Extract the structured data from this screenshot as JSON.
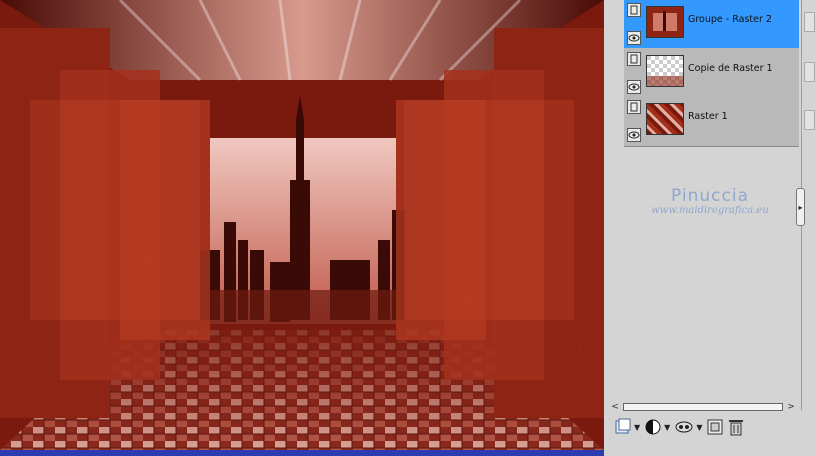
{
  "canvas": {
    "image_description_colors": {
      "primary": "#9a2a17",
      "dark": "#5e120a",
      "light": "#e3b0a3"
    }
  },
  "layers": [
    {
      "name": "Groupe - Raster 2",
      "selected": true,
      "visible": true
    },
    {
      "name": "Copie de Raster 1",
      "selected": false,
      "visible": true
    },
    {
      "name": "Raster 1",
      "selected": false,
      "visible": true
    }
  ],
  "watermark": {
    "name": "Pinuccia",
    "url": "www.maidiregrafica.eu"
  },
  "toolbar": {
    "icons": [
      "new-layer-icon",
      "adjustment-layer-icon",
      "mask-icon",
      "delete-layer-icon"
    ]
  },
  "colors": {
    "selection": "#3399ff",
    "panel_bg": "#d4d4d4",
    "layer_list_bg": "#b9b9b9",
    "bottom_strip": "#2c3bb0"
  }
}
